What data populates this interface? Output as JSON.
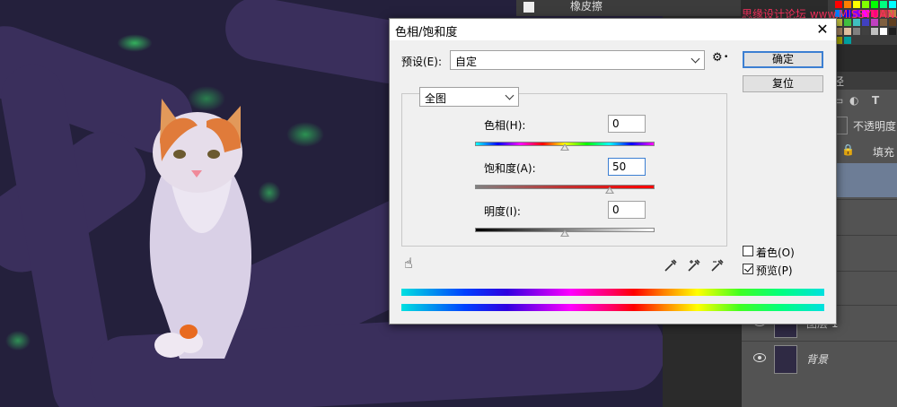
{
  "background_ui": {
    "top_tool_label": "橡皮擦",
    "watermark": "思缘设计论坛 www.MISSYUAN.COM",
    "layers_tab_fragment": "径",
    "opacity_label": "不透明度",
    "fill_label": "填充",
    "layers": [
      {
        "name": "图层 1"
      },
      {
        "name": "背景"
      }
    ]
  },
  "dialog": {
    "title": "色相/饱和度",
    "close_glyph": "✕",
    "preset_label": "预设(E):",
    "preset_value": "自定",
    "gear_glyph": "⚙",
    "ok_label": "确定",
    "reset_label": "复位",
    "channel_value": "全图",
    "hue": {
      "label": "色相(H):",
      "value": "0",
      "level": 0
    },
    "saturation": {
      "label": "饱和度(A):",
      "value": "50",
      "level": 50
    },
    "lightness": {
      "label": "明度(I):",
      "value": "0",
      "level": 0
    },
    "colorize": {
      "label": "着色(O)",
      "checked": false
    },
    "preview": {
      "label": "预览(P)",
      "checked": true
    },
    "hand_glyph": "☝"
  }
}
